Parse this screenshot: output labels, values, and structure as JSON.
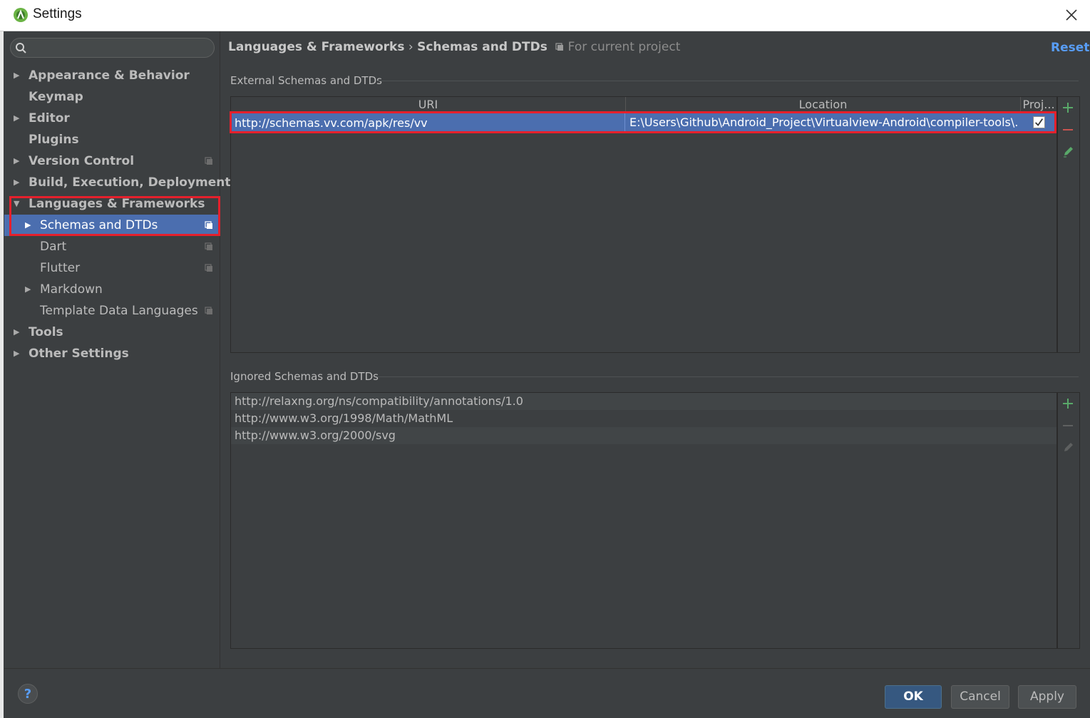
{
  "window": {
    "title": "Settings"
  },
  "sidebar": {
    "search": {
      "placeholder": ""
    },
    "items": [
      {
        "label": "Appearance & Behavior",
        "expanded": false,
        "has_children": true,
        "level": 0
      },
      {
        "label": "Keymap",
        "has_children": false,
        "level": 0
      },
      {
        "label": "Editor",
        "expanded": false,
        "has_children": true,
        "level": 0
      },
      {
        "label": "Plugins",
        "has_children": false,
        "level": 0
      },
      {
        "label": "Version Control",
        "expanded": false,
        "has_children": true,
        "level": 0,
        "project_scoped": true
      },
      {
        "label": "Build, Execution, Deployment",
        "expanded": false,
        "has_children": true,
        "level": 0
      },
      {
        "label": "Languages & Frameworks",
        "expanded": true,
        "has_children": true,
        "level": 0
      },
      {
        "label": "Schemas and DTDs",
        "expanded": false,
        "has_children": true,
        "level": 1,
        "selected": true,
        "project_scoped": true
      },
      {
        "label": "Dart",
        "has_children": false,
        "level": 1,
        "project_scoped": true
      },
      {
        "label": "Flutter",
        "has_children": false,
        "level": 1,
        "project_scoped": true
      },
      {
        "label": "Markdown",
        "expanded": false,
        "has_children": true,
        "level": 1
      },
      {
        "label": "Template Data Languages",
        "has_children": false,
        "level": 1,
        "project_scoped": true
      },
      {
        "label": "Tools",
        "expanded": false,
        "has_children": true,
        "level": 0
      },
      {
        "label": "Other Settings",
        "expanded": false,
        "has_children": true,
        "level": 0
      }
    ]
  },
  "header": {
    "breadcrumb_parent": "Languages & Frameworks",
    "breadcrumb_separator": "›",
    "breadcrumb_current": "Schemas and DTDs",
    "scope_note": "For current project",
    "reset_label": "Reset"
  },
  "external": {
    "section_label": "External Schemas and DTDs",
    "columns": {
      "uri": "URI",
      "location": "Location",
      "project": "Proj..."
    },
    "rows": [
      {
        "uri": "http://schemas.vv.com/apk/res/vv",
        "location": "E:\\Users\\Github\\Android_Project\\Virtualview-Android\\compiler-tools\\...",
        "project": true
      }
    ]
  },
  "ignored": {
    "section_label": "Ignored Schemas and DTDs",
    "rows": [
      "http://relaxng.org/ns/compatibility/annotations/1.0",
      "http://www.w3.org/1998/Math/MathML",
      "http://www.w3.org/2000/svg"
    ]
  },
  "buttons": {
    "ok": "OK",
    "cancel": "Cancel",
    "apply": "Apply",
    "help": "?"
  },
  "colors": {
    "selection": "#4b6eaf",
    "accent_link": "#589df6",
    "add": "#59a869",
    "remove": "#c75450",
    "highlight_box": "#e5202c"
  }
}
